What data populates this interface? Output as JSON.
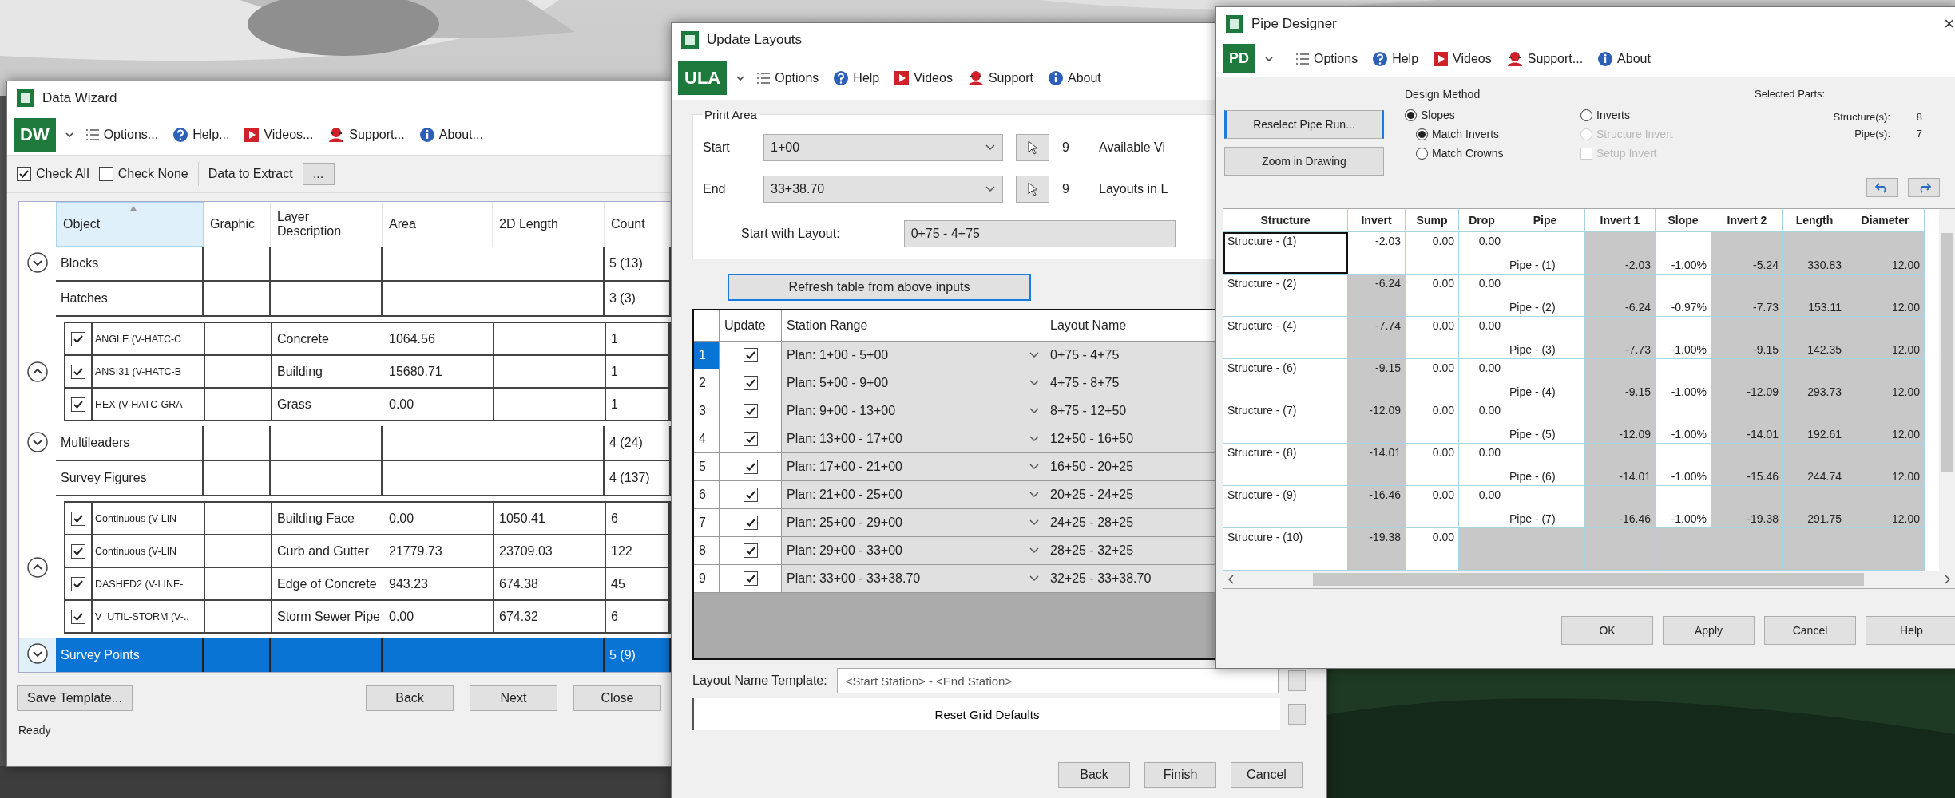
{
  "data_wizard": {
    "title": "Data Wizard",
    "logo": "DW",
    "menu": [
      "Options...",
      "Help...",
      "Videos...",
      "Support...",
      "About..."
    ],
    "check_all": {
      "label": "Check All",
      "checked": true
    },
    "check_none": {
      "label": "Check None",
      "checked": false
    },
    "data_to_extract": {
      "label": "Data to Extract",
      "button": "..."
    },
    "columns": [
      "Object",
      "Graphic",
      "Layer Description",
      "Area",
      "2D Length",
      "Count"
    ],
    "groups": [
      {
        "name": "Blocks",
        "count": "5 (13)",
        "expanded": false,
        "selected": false
      },
      {
        "name": "Hatches",
        "count": "3 (3)",
        "expanded": true,
        "selected": false,
        "children": [
          {
            "name": "ANGLE (V-HATC-C",
            "layer": "Concrete",
            "area": "1064.56",
            "count": "1",
            "checked": true
          },
          {
            "name": "ANSI31 (V-HATC-B",
            "layer": "Building",
            "area": "15680.71",
            "count": "1",
            "checked": true
          },
          {
            "name": "HEX (V-HATC-GRA",
            "layer": "Grass",
            "area": "0.00",
            "count": "1",
            "checked": true
          }
        ]
      },
      {
        "name": "Multileaders",
        "count": "4 (24)",
        "expanded": false,
        "selected": false
      },
      {
        "name": "Survey Figures",
        "count": "4 (137)",
        "expanded": true,
        "selected": false,
        "children": [
          {
            "name": "Continuous (V-LIN",
            "layer": "Building Face",
            "area": "0.00",
            "length": "1050.41",
            "count": "6",
            "checked": true
          },
          {
            "name": "Continuous (V-LIN",
            "layer": "Curb and Gutter",
            "area": "21779.73",
            "length": "23709.03",
            "count": "122",
            "checked": true
          },
          {
            "name": "DASHED2 (V-LINE-",
            "layer": "Edge of Concrete",
            "area": "943.23",
            "length": "674.38",
            "count": "45",
            "checked": true
          },
          {
            "name": "V_UTIL-STORM (V-..",
            "layer": "Storm Sewer Pipe",
            "area": "0.00",
            "length": "674.32",
            "count": "6",
            "checked": true
          }
        ]
      },
      {
        "name": "Survey Points",
        "count": "5 (9)",
        "expanded": false,
        "selected": true
      }
    ],
    "footer_buttons": [
      "Save Template...",
      "Back",
      "Next",
      "Close"
    ],
    "status": "Ready"
  },
  "update_layouts": {
    "title": "Update Layouts",
    "logo": "ULA",
    "menu": [
      "Options",
      "Help",
      "Videos",
      "Support",
      "About"
    ],
    "print_area": {
      "title": "Print Area",
      "start": {
        "label": "Start",
        "value": "1+00"
      },
      "end": {
        "label": "End",
        "value": "33+38.70"
      },
      "available": {
        "count": "9",
        "label": "Available Vi"
      },
      "layouts": {
        "count": "9",
        "label": "Layouts in L"
      },
      "start_with": {
        "label": "Start with Layout:",
        "value": "0+75 - 4+75"
      }
    },
    "refresh_button": "Refresh table from above inputs",
    "columns": [
      "Update",
      "Station Range",
      "Layout Name"
    ],
    "rows": [
      {
        "index": "1",
        "selected": true,
        "checked": true,
        "station_range": "Plan: 1+00 - 5+00",
        "layout_name": "0+75 - 4+75"
      },
      {
        "index": "2",
        "selected": false,
        "checked": true,
        "station_range": "Plan: 5+00 - 9+00",
        "layout_name": "4+75 - 8+75"
      },
      {
        "index": "3",
        "selected": false,
        "checked": true,
        "station_range": "Plan: 9+00 - 13+00",
        "layout_name": "8+75 - 12+50"
      },
      {
        "index": "4",
        "selected": false,
        "checked": true,
        "station_range": "Plan: 13+00 - 17+00",
        "layout_name": "12+50 - 16+50"
      },
      {
        "index": "5",
        "selected": false,
        "checked": true,
        "station_range": "Plan: 17+00 - 21+00",
        "layout_name": "16+50 - 20+25"
      },
      {
        "index": "6",
        "selected": false,
        "checked": true,
        "station_range": "Plan: 21+00 - 25+00",
        "layout_name": "20+25 - 24+25"
      },
      {
        "index": "7",
        "selected": false,
        "checked": true,
        "station_range": "Plan: 25+00 - 29+00",
        "layout_name": "24+25 - 28+25"
      },
      {
        "index": "8",
        "selected": false,
        "checked": true,
        "station_range": "Plan: 29+00 - 33+00",
        "layout_name": "28+25 - 32+25"
      },
      {
        "index": "9",
        "selected": false,
        "checked": true,
        "station_range": "Plan: 33+00 - 33+38.70",
        "layout_name": "32+25 - 33+38.70"
      }
    ],
    "template": {
      "label": "Layout Name Template:",
      "value": "<Start Station> - <End Station>"
    },
    "reset_button": "Reset Grid Defaults",
    "footer_buttons": [
      "Back",
      "Finish",
      "Cancel"
    ]
  },
  "pipe_designer": {
    "title": "Pipe Designer",
    "close": "×",
    "logo": "PD",
    "menu": [
      "Options",
      "Help",
      "Videos",
      "Support...",
      "About"
    ],
    "actions": [
      "Reselect Pipe Run...",
      "Zoom in Drawing"
    ],
    "design_method": {
      "title": "Design Method",
      "options": [
        {
          "label": "Slopes",
          "kind": "radio",
          "selected": true,
          "disabled": false
        },
        {
          "label": "Inverts",
          "kind": "radio",
          "selected": false,
          "disabled": false
        },
        {
          "label": "Match Inverts",
          "kind": "radio",
          "selected": true,
          "disabled": false
        },
        {
          "label": "Structure Invert",
          "kind": "radio",
          "selected": false,
          "disabled": true
        },
        {
          "label": "Match Crowns",
          "kind": "radio",
          "selected": false,
          "disabled": false
        },
        {
          "label": "Setup Invert",
          "kind": "checkbox",
          "selected": false,
          "disabled": true
        }
      ]
    },
    "selected_parts": {
      "title": "Selected Parts:",
      "items": [
        {
          "label": "Structure(s):",
          "value": "8"
        },
        {
          "label": "Pipe(s):",
          "value": "7"
        }
      ]
    },
    "columns": [
      "Structure",
      "Invert",
      "Sump",
      "Drop",
      "Pipe",
      "Invert 1",
      "Slope",
      "Invert 2",
      "Length",
      "Diameter"
    ],
    "rows": [
      {
        "structure": "Structure - (1)",
        "focused": true,
        "invert": "-2.03",
        "invert_editable": true,
        "sump": "0.00",
        "drop": "0.00",
        "pipe": {
          "name": "Pipe - (1)",
          "invert_1": "-2.03",
          "slope": "-1.00%",
          "invert_2": "-5.24",
          "length": "330.83",
          "diameter": "12.00"
        }
      },
      {
        "structure": "Structure - (2)",
        "focused": false,
        "invert": "-6.24",
        "invert_editable": false,
        "sump": "0.00",
        "drop": "0.00",
        "pipe": {
          "name": "Pipe - (2)",
          "invert_1": "-6.24",
          "slope": "-0.97%",
          "invert_2": "-7.73",
          "length": "153.11",
          "diameter": "12.00"
        }
      },
      {
        "structure": "Structure - (4)",
        "focused": false,
        "invert": "-7.74",
        "invert_editable": false,
        "sump": "0.00",
        "drop": "0.00",
        "pipe": {
          "name": "Pipe - (3)",
          "invert_1": "-7.73",
          "slope": "-1.00%",
          "invert_2": "-9.15",
          "length": "142.35",
          "diameter": "12.00"
        }
      },
      {
        "structure": "Structure - (6)",
        "focused": false,
        "invert": "-9.15",
        "invert_editable": false,
        "sump": "0.00",
        "drop": "0.00",
        "pipe": {
          "name": "Pipe - (4)",
          "invert_1": "-9.15",
          "slope": "-1.00%",
          "invert_2": "-12.09",
          "length": "293.73",
          "diameter": "12.00"
        }
      },
      {
        "structure": "Structure - (7)",
        "focused": false,
        "invert": "-12.09",
        "invert_editable": false,
        "sump": "0.00",
        "drop": "0.00",
        "pipe": {
          "name": "Pipe - (5)",
          "invert_1": "-12.09",
          "slope": "-1.00%",
          "invert_2": "-14.01",
          "length": "192.61",
          "diameter": "12.00"
        }
      },
      {
        "structure": "Structure - (8)",
        "focused": false,
        "invert": "-14.01",
        "invert_editable": false,
        "sump": "0.00",
        "drop": "0.00",
        "pipe": {
          "name": "Pipe - (6)",
          "invert_1": "-14.01",
          "slope": "-1.00%",
          "invert_2": "-15.46",
          "length": "244.74",
          "diameter": "12.00"
        }
      },
      {
        "structure": "Structure - (9)",
        "focused": false,
        "invert": "-16.46",
        "invert_editable": false,
        "sump": "0.00",
        "drop": "0.00",
        "pipe": {
          "name": "Pipe - (7)",
          "invert_1": "-16.46",
          "slope": "-1.00%",
          "invert_2": "-19.38",
          "length": "291.75",
          "diameter": "12.00"
        }
      },
      {
        "structure": "Structure - (10)",
        "focused": false,
        "invert": "-19.38",
        "invert_editable": false,
        "sump": "0.00"
      }
    ],
    "footer_buttons": [
      "OK",
      "Apply",
      "Cancel",
      "Help"
    ]
  }
}
